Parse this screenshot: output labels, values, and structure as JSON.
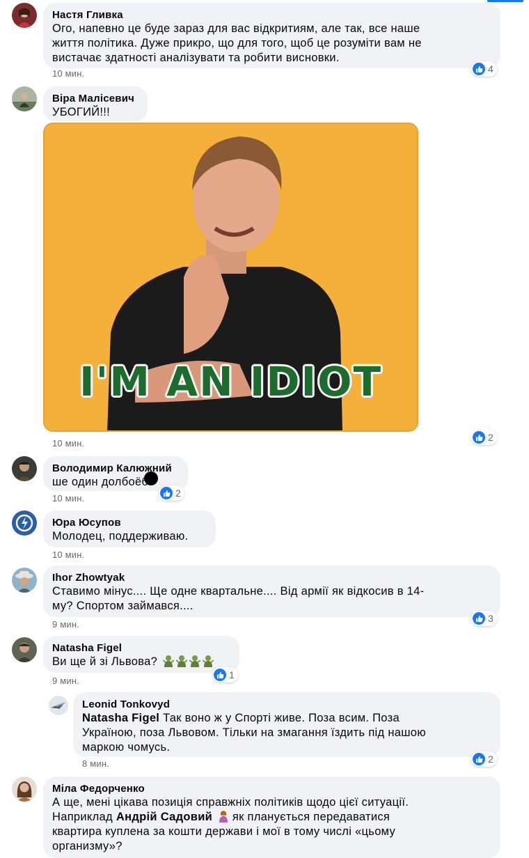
{
  "comments": [
    {
      "author": "Настя Гливка",
      "lines": [
        "Ого, напевно це буде зараз для вас відкритиям, але так, все наше",
        "життя політика. Дуже прикро, що для того, щоб це розуміти вам не",
        "вистачає здатності аналізувати та робити висновки."
      ],
      "time": "10 мин.",
      "reactions": "4"
    },
    {
      "author": "Віра Малісевич",
      "lines": [
        "УБОГИЙ!!!"
      ],
      "time": "10 мин.",
      "reactions": "2",
      "gif_caption": "I'M AN IDIOT"
    },
    {
      "author": "Володимир Калюжний",
      "lines": [
        "ше один долбоёб"
      ],
      "time": "10 мин.",
      "reactions": "2"
    },
    {
      "author": "Юра Юсупов",
      "lines": [
        "Молодец, поддерживаю."
      ],
      "time": "10 мин."
    },
    {
      "author": "Ihor Zhowtyak",
      "lines": [
        "Ставимо мінус.... Ще одне квартальне.... Від армії як відкосив в 14-",
        "му? Спортом займався...."
      ],
      "time": "9 мин.",
      "reactions": "3"
    },
    {
      "author": "Natasha Figel",
      "lines": [
        "Ви ще й зі Львова?"
      ],
      "time": "9 мин.",
      "reactions": "1"
    },
    {
      "author": "Leonid Tonkovyd",
      "mention": "Natasha Figel",
      "lines": [
        "Так воно ж у Спорті живе. Поза всим. Поза",
        "Україною, поза Львовом. Тільки на змагання їздить під нашою",
        "маркою чомусь."
      ],
      "time": "8 мин.",
      "reactions": "2"
    },
    {
      "author": "Міла Федорченко",
      "mention": "Андрій Садовий",
      "lines": [
        "А ще, мені цікава позиція справжніх політиків щодо цієї ситуації.",
        "Наприклад",
        "як планується передаватися",
        "квартира куплена за кошти держави і мої в тому числі «цьому",
        "организму»?"
      ]
    }
  ],
  "colors": {
    "accent": "#1877f2",
    "bubble": "#f0f2f5",
    "gif_bg": "#f4b03b",
    "gif_text": "#1d6b2d"
  }
}
